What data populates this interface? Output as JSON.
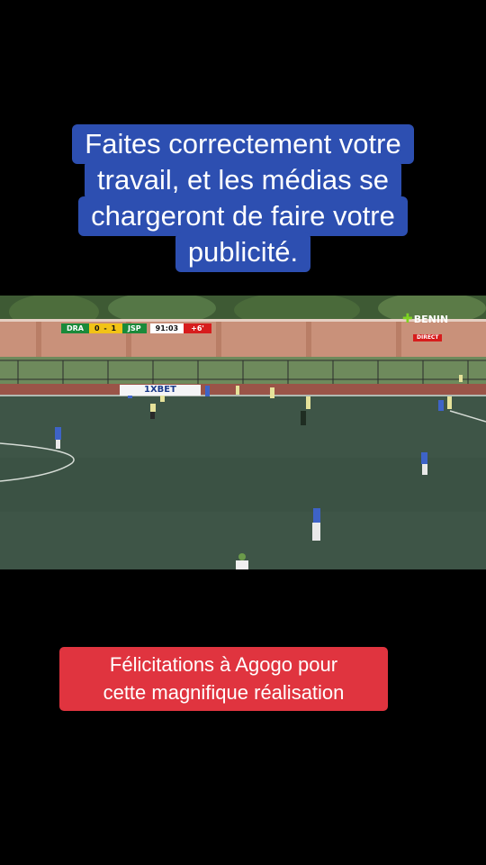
{
  "top_caption": {
    "lines": [
      "Faites correctement votre",
      "travail, et les médias se",
      "chargeront de faire votre",
      "publicité."
    ],
    "background_color": "#2d4fb1"
  },
  "video": {
    "scoreboard": {
      "home_team": "DRA",
      "score": "0 - 1",
      "away_team": "JSP",
      "clock": "91:03",
      "added_time": "+6'"
    },
    "channel_logo": {
      "name": "BENIN",
      "tag": "DIRECT",
      "icon": "plus-cross-icon"
    },
    "sponsor_board": "1XBET"
  },
  "bottom_caption": {
    "lines": [
      "Félicitations à Agogo pour",
      "cette magnifique réalisation"
    ],
    "background_color": "#e0343f"
  }
}
